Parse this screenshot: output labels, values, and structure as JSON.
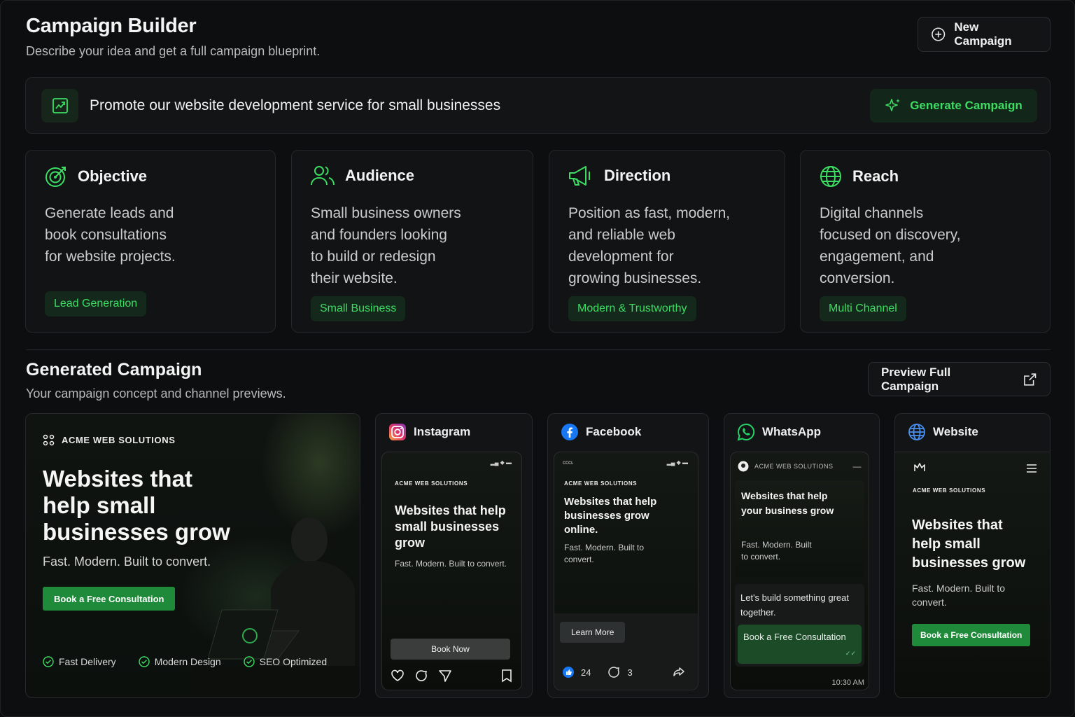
{
  "header": {
    "title": "Campaign Builder",
    "subtitle": "Describe your idea and get a full campaign blueprint.",
    "new_campaign_label": "New Campaign"
  },
  "prompt": {
    "text": "Promote our website development service for small businesses",
    "generate_label": "Generate Campaign",
    "icon": "edit-chart-icon"
  },
  "cards": [
    {
      "icon": "target-icon",
      "title": "Objective",
      "lines": [
        "Generate leads and",
        "book consultations",
        "for website projects."
      ],
      "tag": "Lead Generation"
    },
    {
      "icon": "users-icon",
      "title": "Audience",
      "lines": [
        "Small business owners",
        "and founders looking",
        "to build or redesign",
        "their website."
      ],
      "tag": "Small Business"
    },
    {
      "icon": "megaphone-icon",
      "title": "Direction",
      "lines": [
        "Position as fast, modern,",
        "and reliable web",
        "development for",
        "growing businesses."
      ],
      "tag": "Modern & Trustworthy"
    },
    {
      "icon": "globe-icon",
      "title": "Reach",
      "lines": [
        "Digital channels",
        "focused on discovery,",
        "engagement, and",
        "conversion."
      ],
      "tag": "Multi Channel"
    }
  ],
  "generated": {
    "title": "Generated Campaign",
    "subtitle": "Your campaign concept and channel previews.",
    "preview_label": "Preview Full Campaign"
  },
  "hero": {
    "brand": "ACME WEB SOLUTIONS",
    "headline": "Websites that help small businesses grow",
    "tagline": "Fast. Modern. Built to convert.",
    "cta": "Book a Free Consultation",
    "features": [
      "Fast Delivery",
      "Modern Design",
      "SEO Optimized"
    ]
  },
  "instagram": {
    "name": "Instagram",
    "brand": "ACME WEB SOLUTIONS",
    "headline": "Websites that help small businesses grow",
    "sub": "Fast. Modern. Built to convert.",
    "button": "Book Now"
  },
  "facebook": {
    "name": "Facebook",
    "brand": "ACME WEB SOLUTIONS",
    "headline": "Websites that help businesses grow online.",
    "sub": "Fast. Modern. Built to convert.",
    "button": "Learn More",
    "likes": "24",
    "comments": "3",
    "carrier": "ᴄᴄᴄʟ"
  },
  "whatsapp": {
    "name": "WhatsApp",
    "brand": "ACME WEB SOLUTIONS",
    "headline": "Websites that help your business grow",
    "sub": "Fast. Modern. Built to convert.",
    "message": "Let's build something great together.",
    "button": "Book a Free Consultation",
    "time": "10:30 AM"
  },
  "website": {
    "name": "Website",
    "brand": "ACME WEB SOLUTIONS",
    "headline": "Websites that help small businesses grow",
    "sub": "Fast. Modern. Built to convert.",
    "button": "Book a Free Consultation"
  },
  "colors": {
    "accent": "#3ddc63",
    "accent_bg": "#14291b",
    "cta": "#1f8a39",
    "background": "#0d0e0f"
  }
}
